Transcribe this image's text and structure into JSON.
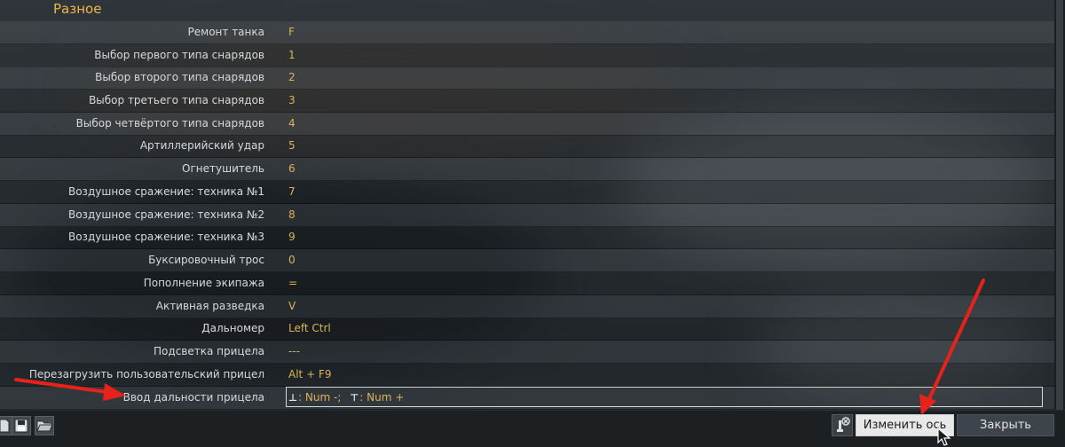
{
  "section": {
    "title": "Разное"
  },
  "rows": [
    {
      "label": "Ремонт танка",
      "value": "F"
    },
    {
      "label": "Выбор первого типа снарядов",
      "value": "1"
    },
    {
      "label": "Выбор второго типа снарядов",
      "value": "2"
    },
    {
      "label": "Выбор третьего типа снарядов",
      "value": "3"
    },
    {
      "label": "Выбор четвёртого типа снарядов",
      "value": "4"
    },
    {
      "label": "Артиллерийский удар",
      "value": "5"
    },
    {
      "label": "Огнетушитель",
      "value": "6"
    },
    {
      "label": "Воздушное сражение: техника №1",
      "value": "7"
    },
    {
      "label": "Воздушное сражение: техника №2",
      "value": "8"
    },
    {
      "label": "Воздушное сражение: техника №3",
      "value": "9"
    },
    {
      "label": "Буксировочный трос",
      "value": "0"
    },
    {
      "label": "Пополнение экипажа",
      "value": "="
    },
    {
      "label": "Активная разведка",
      "value": "V"
    },
    {
      "label": "Дальномер",
      "value": "Left Ctrl"
    },
    {
      "label": "Подсветка прицела",
      "value": "---"
    },
    {
      "label": "Перезагрузить пользовательский прицел",
      "value": "Alt + F9"
    }
  ],
  "selected_row": {
    "label": "Ввод дальности прицела",
    "value_minus": ": Num -;",
    "value_plus": ": Num +"
  },
  "buttons": {
    "change_axis": "Изменить ось",
    "close": "Закрыть"
  },
  "colors": {
    "accent": "#e8b84a",
    "value_text": "#d8b45a",
    "arrow": "#e5231b"
  },
  "icons": [
    "new-file-icon",
    "save-icon",
    "open-folder-icon",
    "axis-reset-icon"
  ]
}
